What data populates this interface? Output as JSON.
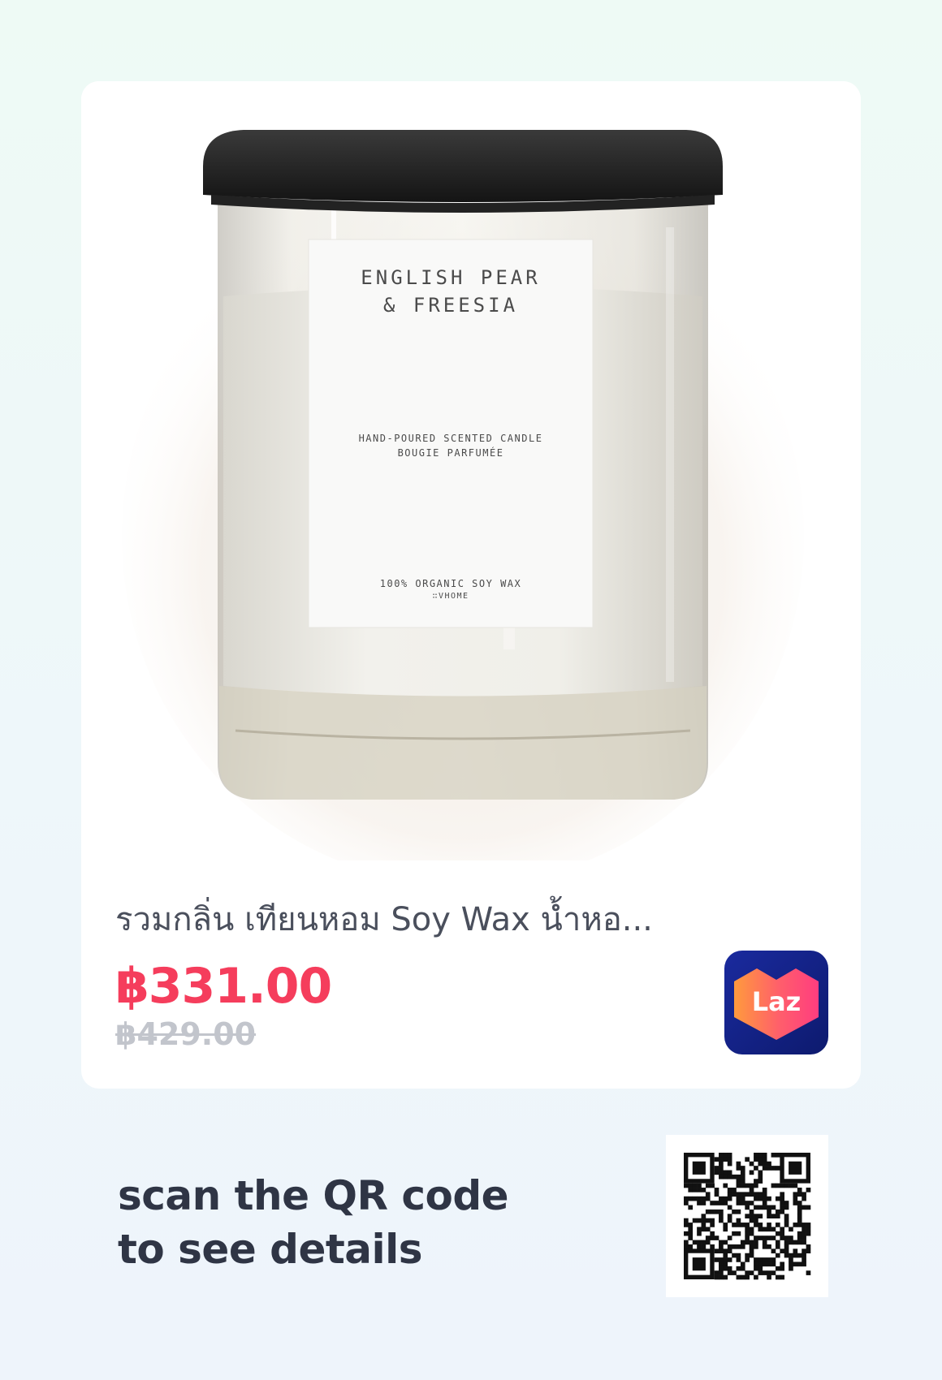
{
  "product": {
    "title": "รวมกลิ่น เทียนหอม Soy Wax น้ำหอ...",
    "price": "฿331.00",
    "original_price": "฿429.00",
    "store": "Laz",
    "image_label": {
      "name_line1": "ENGLISH PEAR",
      "name_line2": "& FREESIA",
      "desc_line1": "HAND-POURED SCENTED CANDLE",
      "desc_line2": "BOUGIE PARFUMÉE",
      "foot_line1": "100% ORGANIC SOY WAX",
      "foot_line2": "∷VHOME"
    }
  },
  "cta": {
    "line1": "scan the QR code",
    "line2": "to see details"
  },
  "colors": {
    "price": "#f53d5c",
    "old_price": "#c2c5cc",
    "cta_text": "#2f3545",
    "lazada_gradient_start": "#1a2a9e",
    "lazada_heart_start": "#ff9a3d",
    "lazada_heart_end": "#ff3d7f"
  },
  "icons": [
    "lazada-logo-icon",
    "qr-code-icon"
  ]
}
